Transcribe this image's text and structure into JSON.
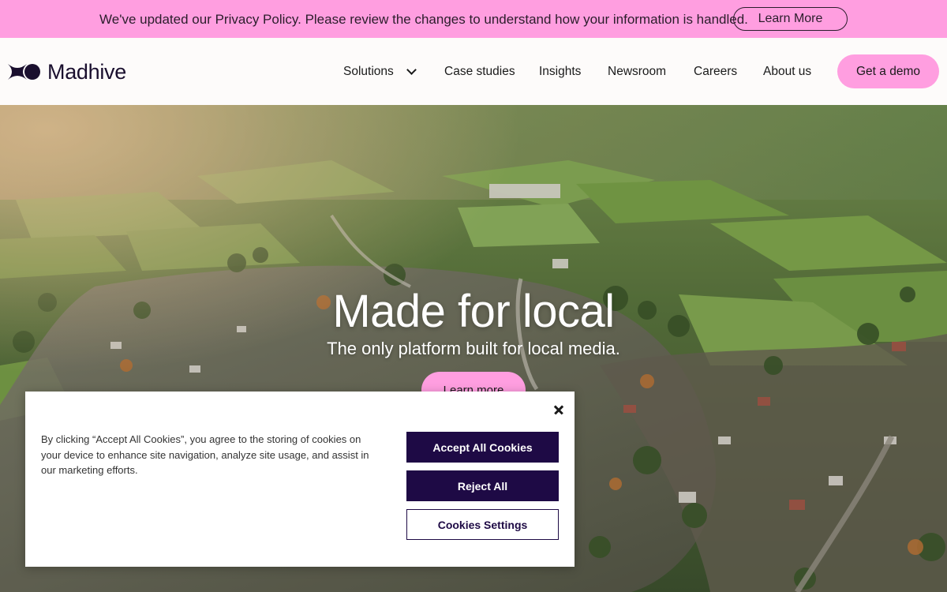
{
  "notice": {
    "text": "We've updated our Privacy Policy. Please review the changes to understand how your information is handled.",
    "button_label": "Learn More"
  },
  "header": {
    "logo_text": "Madhive",
    "nav": {
      "solutions": "Solutions",
      "case_studies": "Case studies",
      "insights": "Insights",
      "newsroom": "Newsroom",
      "careers": "Careers",
      "about_us": "About us"
    },
    "demo_label": "Get a demo"
  },
  "hero": {
    "title": "Made for local",
    "subtitle": "The only platform built for local media.",
    "button_label": "Learn more"
  },
  "cookie": {
    "text": "By clicking “Accept All Cookies”, you agree to the storing of cookies on your device to enhance site navigation, analyze site usage, and assist in our marketing efforts.",
    "accept_label": "Accept All Cookies",
    "reject_label": "Reject All",
    "settings_label": "Cookies Settings"
  },
  "colors": {
    "brand_pink": "#ff9ee0",
    "brand_purple": "#1e0a45"
  }
}
